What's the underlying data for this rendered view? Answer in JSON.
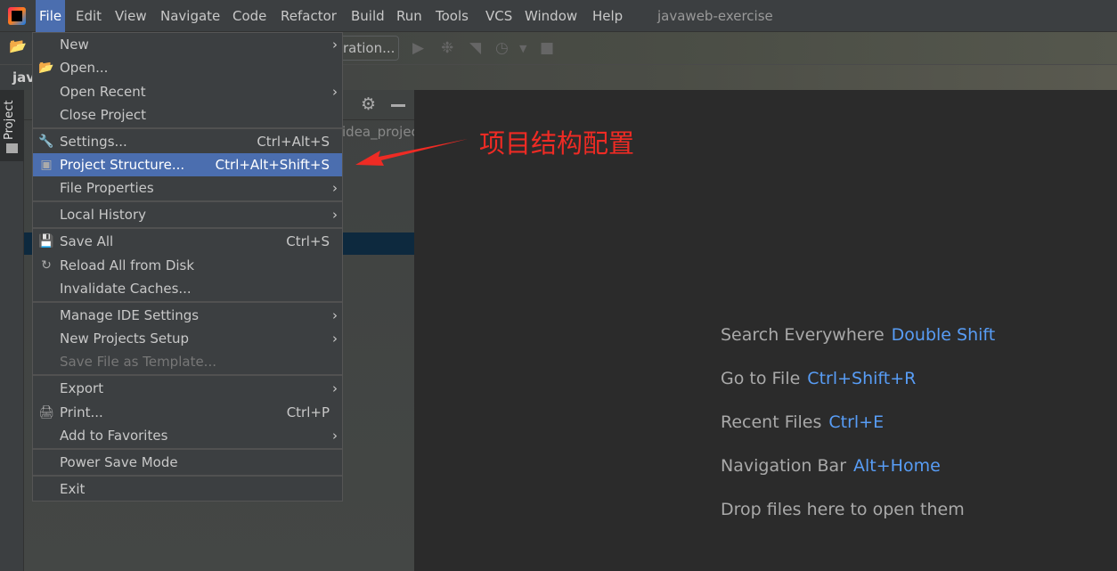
{
  "window_title": "javaweb-exercise",
  "menubar": [
    "File",
    "Edit",
    "View",
    "Navigate",
    "Code",
    "Refactor",
    "Build",
    "Run",
    "Tools",
    "VCS",
    "Window",
    "Help"
  ],
  "toolbar": {
    "run_config_label": "ration..."
  },
  "tab": {
    "label": "jav"
  },
  "left_strip": {
    "project_label": "Project"
  },
  "project_panel": {
    "path_fragment": "idea_projec"
  },
  "file_menu": {
    "items": [
      {
        "label": "New",
        "submenu": true
      },
      {
        "label": "Open...",
        "icon": "folder-open-icon"
      },
      {
        "label": "Open Recent",
        "submenu": true
      },
      {
        "label": "Close Project"
      },
      {
        "label": "Settings...",
        "shortcut": "Ctrl+Alt+S",
        "icon": "wrench-icon"
      },
      {
        "label": "Project Structure...",
        "shortcut": "Ctrl+Alt+Shift+S",
        "icon": "project-structure-icon",
        "selected": true
      },
      {
        "label": "File Properties",
        "submenu": true
      },
      {
        "label": "Local History",
        "submenu": true
      },
      {
        "label": "Save All",
        "shortcut": "Ctrl+S",
        "icon": "save-icon"
      },
      {
        "label": "Reload All from Disk",
        "icon": "reload-icon"
      },
      {
        "label": "Invalidate Caches..."
      },
      {
        "label": "Manage IDE Settings",
        "submenu": true
      },
      {
        "label": "New Projects Setup",
        "submenu": true
      },
      {
        "label": "Save File as Template...",
        "disabled": true
      },
      {
        "label": "Export",
        "submenu": true
      },
      {
        "label": "Print...",
        "shortcut": "Ctrl+P",
        "icon": "print-icon"
      },
      {
        "label": "Add to Favorites",
        "submenu": true
      },
      {
        "label": "Power Save Mode"
      },
      {
        "label": "Exit"
      }
    ]
  },
  "annotation": {
    "text": "项目结构配置",
    "color": "#ee2b24"
  },
  "welcome": [
    {
      "label": "Search Everywhere",
      "key": "Double Shift"
    },
    {
      "label": "Go to File",
      "key": "Ctrl+Shift+R"
    },
    {
      "label": "Recent Files",
      "key": "Ctrl+E"
    },
    {
      "label": "Navigation Bar",
      "key": "Alt+Home"
    },
    {
      "label": "Drop files here to open them"
    }
  ],
  "colors": {
    "selection": "#4b6eaf",
    "shortcut": "#589df6"
  }
}
